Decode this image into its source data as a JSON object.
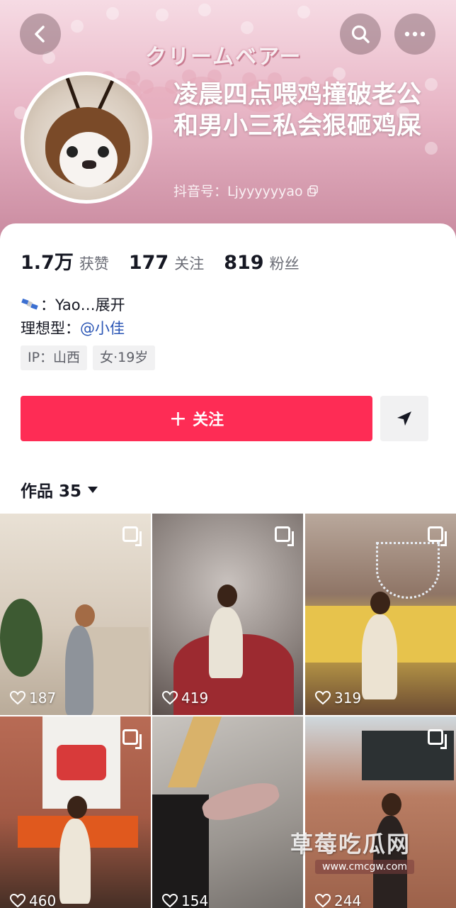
{
  "header": {
    "brand_text": "クリームベアー",
    "nickname": "凌晨四点喂鸡撞破老公和男小三私会狠砸鸡屎",
    "douyin_id": "抖音号：Ljyyyyyyao",
    "colors": {
      "top": "#f6dbe4",
      "bottom": "#c98a9f"
    }
  },
  "nav": {
    "back_icon": "chevron-left-icon",
    "search_icon": "search-icon",
    "more_icon": "more-dots-icon"
  },
  "stats": [
    {
      "value": "1.7万",
      "label": "获赞"
    },
    {
      "value": "177",
      "label": "关注"
    },
    {
      "value": "819",
      "label": "粉丝"
    }
  ],
  "bio": {
    "line1_suffix": "：Yao",
    "expand_label": "…展开",
    "line2_prefix": "理想型：",
    "mention": "@小佳"
  },
  "tags": [
    "IP：山西",
    "女·19岁"
  ],
  "actions": {
    "follow_label": "关注",
    "follow_color": "#fe2c55",
    "send_icon": "send-icon"
  },
  "works": {
    "tab_label": "作品 35"
  },
  "grid": [
    {
      "likes": "187"
    },
    {
      "likes": "419"
    },
    {
      "likes": "319"
    },
    {
      "likes": "460"
    },
    {
      "likes": "154"
    },
    {
      "likes": "244"
    }
  ],
  "watermark": {
    "text": "草莓吃瓜网",
    "url": "www.cmcgw.com"
  }
}
